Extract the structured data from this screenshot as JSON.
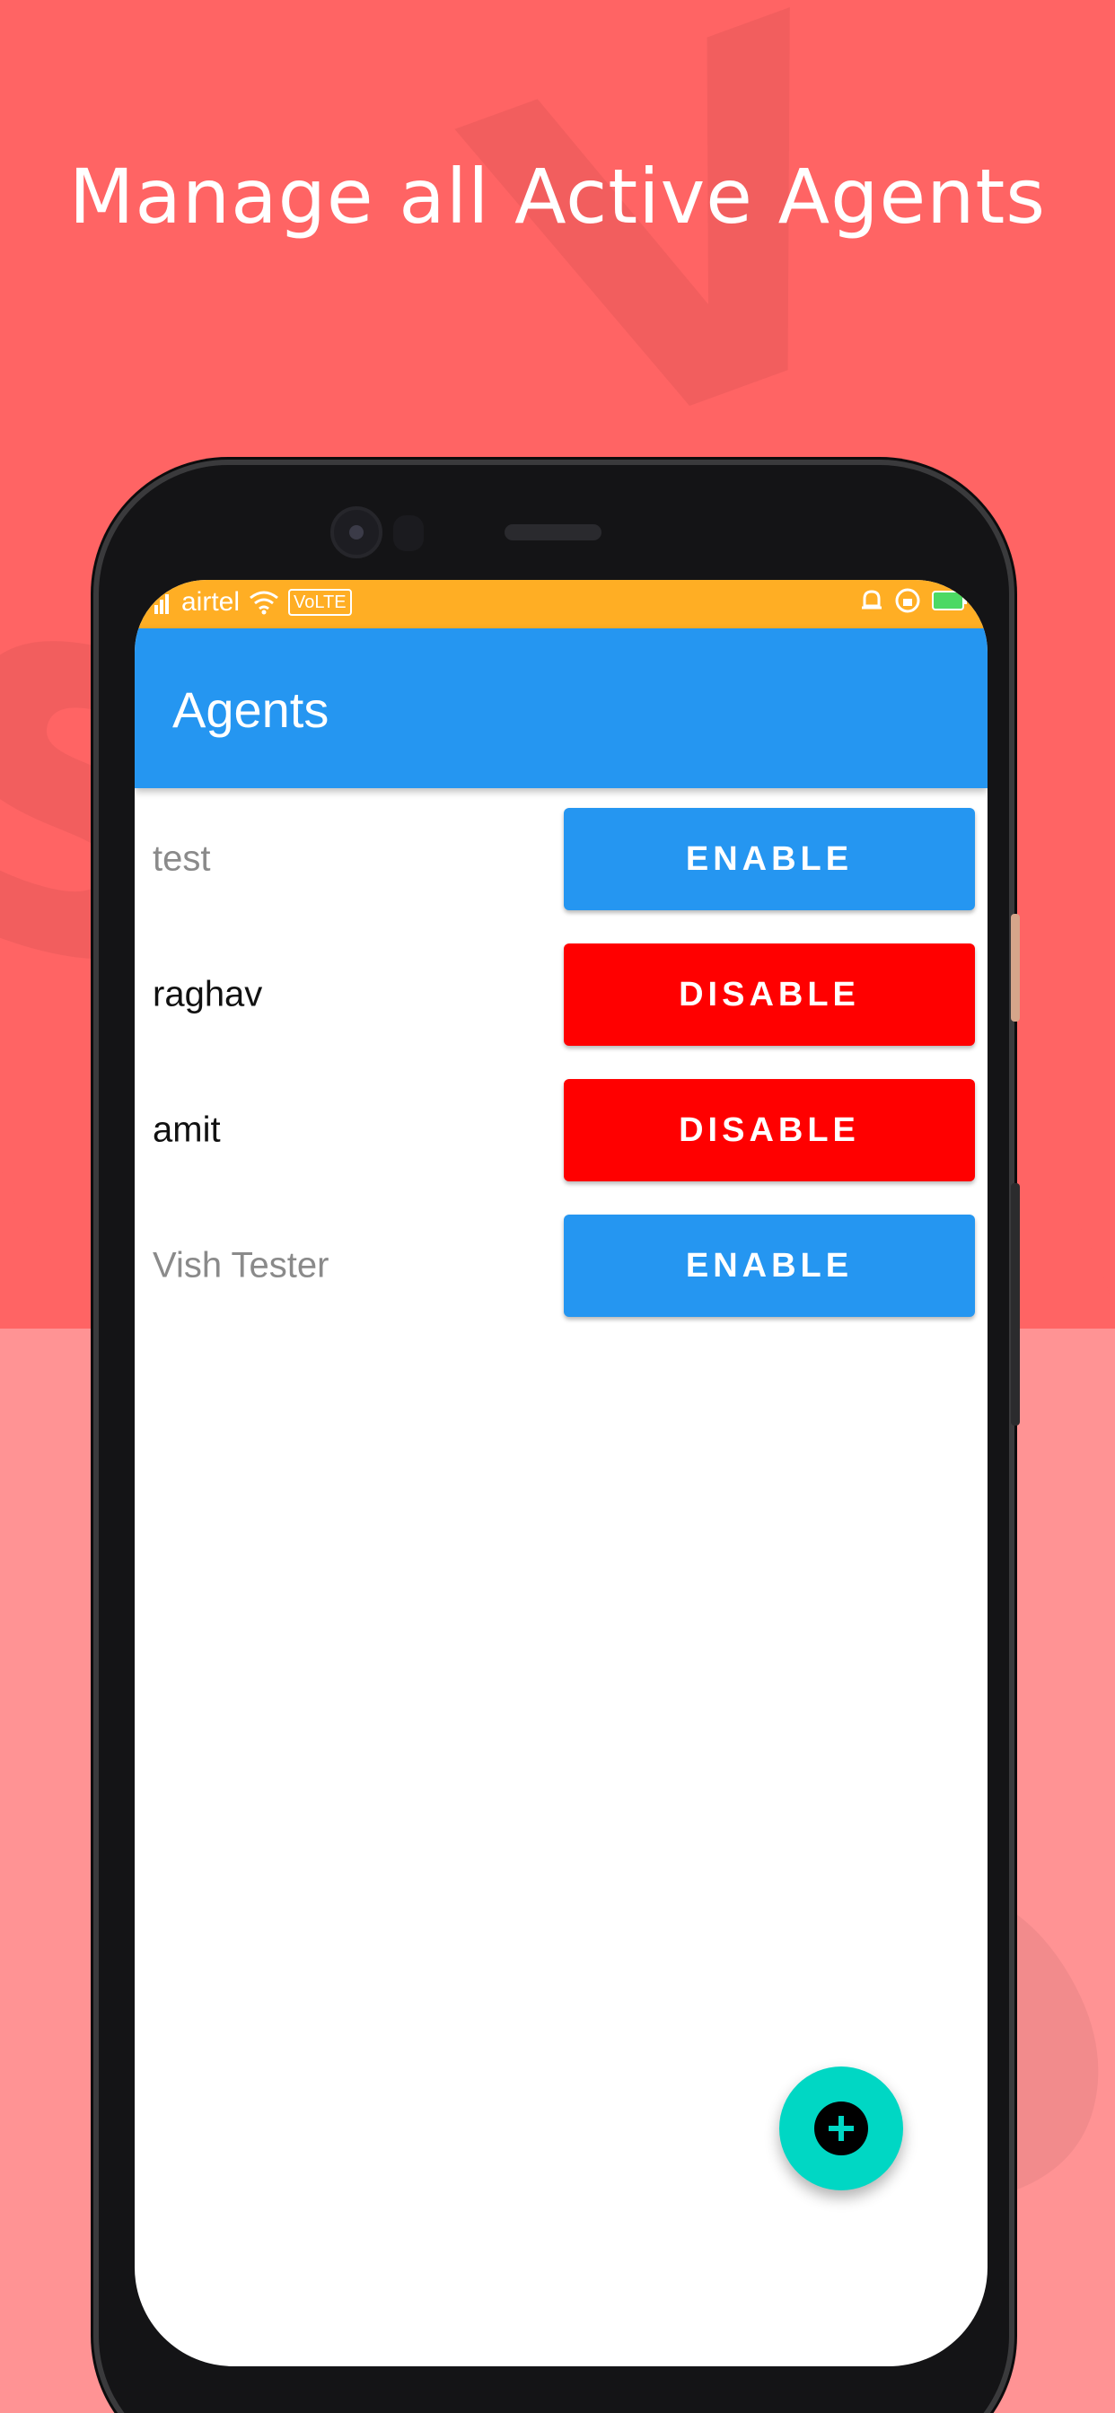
{
  "headline": "Manage all Active Agents",
  "status_bar": {
    "carrier": "airtel",
    "network_badge": "VoLTE",
    "icons_left": [
      "signal-icon",
      "wifi-icon"
    ],
    "icons_right": [
      "alarm-icon",
      "rotation-lock-icon",
      "battery-icon"
    ]
  },
  "app_bar": {
    "title": "Agents"
  },
  "agents": [
    {
      "name": "test",
      "action_label": "ENABLE",
      "status": "disabled"
    },
    {
      "name": "raghav",
      "action_label": "DISABLE",
      "status": "enabled"
    },
    {
      "name": "amit",
      "action_label": "DISABLE",
      "status": "enabled"
    },
    {
      "name": "Vish Tester",
      "action_label": "ENABLE",
      "status": "disabled"
    }
  ],
  "fab": {
    "icon": "plus-icon"
  },
  "colors": {
    "background_top": "#FF6464",
    "background_bottom": "#FF9394",
    "status_bar": "#FFAE24",
    "app_bar": "#2596F1",
    "enable_button": "#2596F1",
    "disable_button": "#FF0000",
    "fab": "#00D7C4"
  }
}
